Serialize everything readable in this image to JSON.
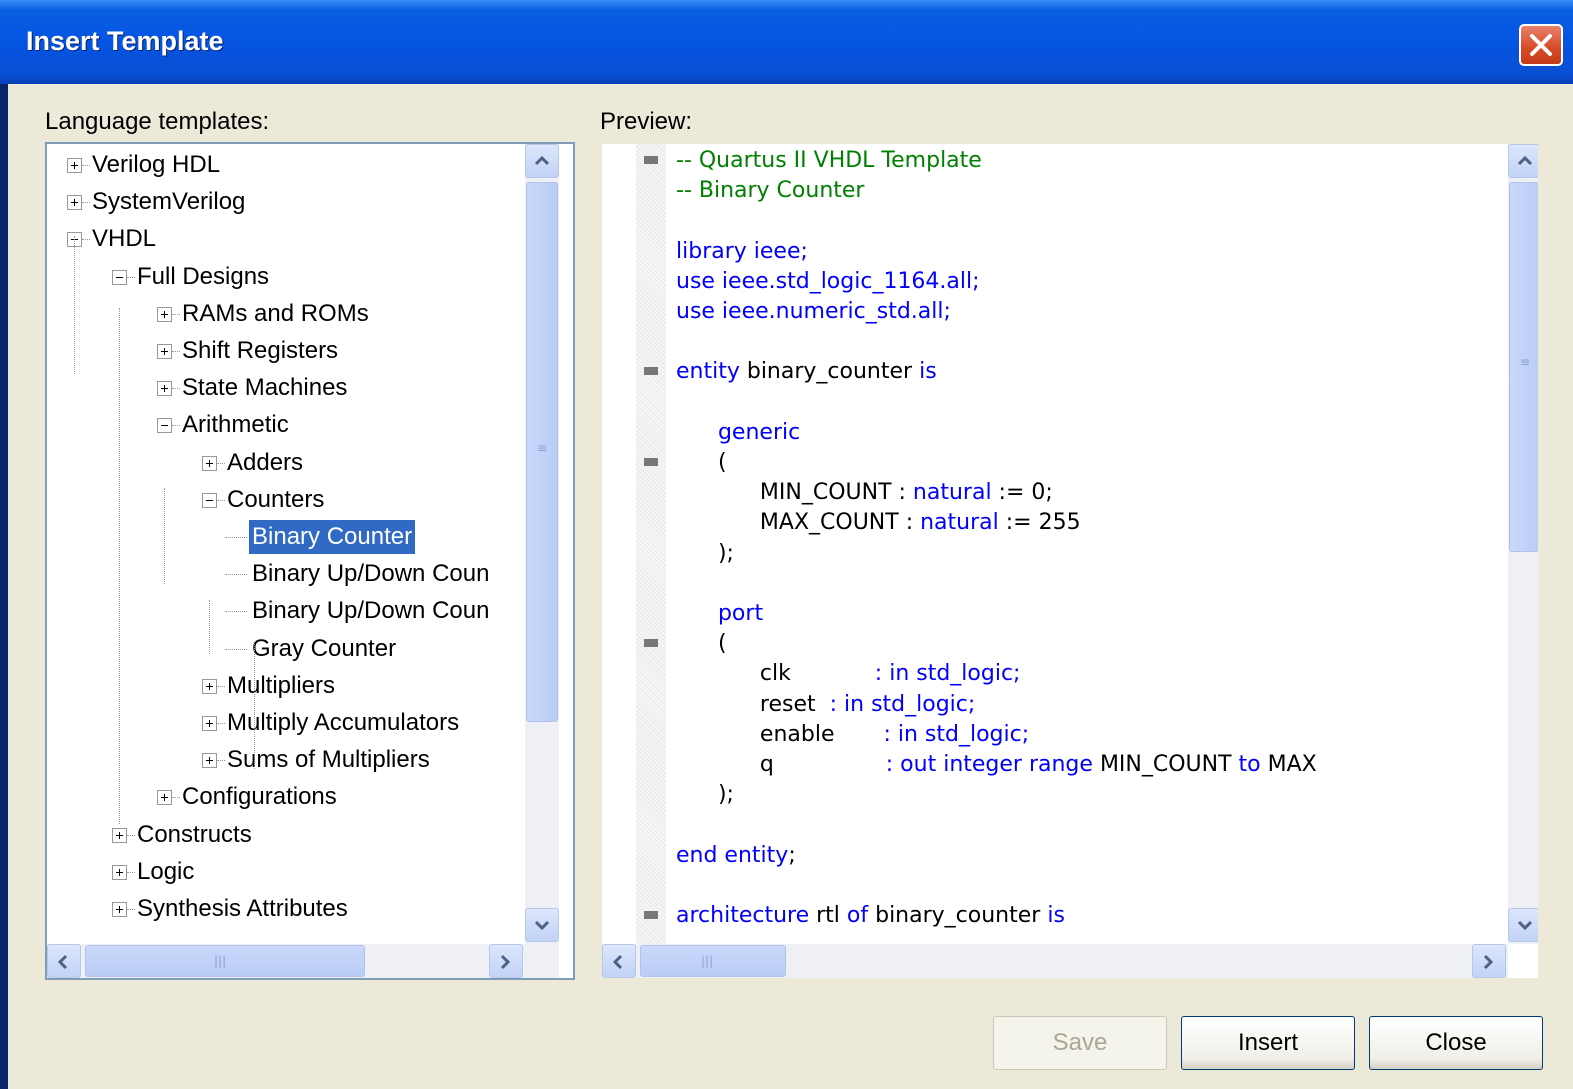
{
  "window": {
    "title": "Insert Template"
  },
  "left_panel": {
    "label": "Language templates:"
  },
  "right_panel": {
    "label": "Preview:"
  },
  "tree": [
    {
      "label": "Verilog HDL",
      "level": 0,
      "expander": "plus"
    },
    {
      "label": "SystemVerilog",
      "level": 0,
      "expander": "plus"
    },
    {
      "label": "VHDL",
      "level": 0,
      "expander": "minus"
    },
    {
      "label": "Full Designs",
      "level": 1,
      "expander": "minus"
    },
    {
      "label": "RAMs and ROMs",
      "level": 2,
      "expander": "plus"
    },
    {
      "label": "Shift Registers",
      "level": 2,
      "expander": "plus"
    },
    {
      "label": "State Machines",
      "level": 2,
      "expander": "plus"
    },
    {
      "label": "Arithmetic",
      "level": 2,
      "expander": "minus"
    },
    {
      "label": "Adders",
      "level": 3,
      "expander": "plus"
    },
    {
      "label": "Counters",
      "level": 3,
      "expander": "minus"
    },
    {
      "label": "Binary Counter",
      "level": 4,
      "expander": "none",
      "selected": true
    },
    {
      "label": "Binary Up/Down Coun",
      "level": 4,
      "expander": "none"
    },
    {
      "label": "Binary Up/Down Coun",
      "level": 4,
      "expander": "none"
    },
    {
      "label": "Gray Counter",
      "level": 4,
      "expander": "none"
    },
    {
      "label": "Multipliers",
      "level": 3,
      "expander": "plus"
    },
    {
      "label": "Multiply Accumulators",
      "level": 3,
      "expander": "plus"
    },
    {
      "label": "Sums of Multipliers",
      "level": 3,
      "expander": "plus"
    },
    {
      "label": "Configurations",
      "level": 2,
      "expander": "plus"
    },
    {
      "label": "Constructs",
      "level": 1,
      "expander": "plus"
    },
    {
      "label": "Logic",
      "level": 1,
      "expander": "plus"
    },
    {
      "label": "Synthesis Attributes",
      "level": 1,
      "expander": "plus"
    }
  ],
  "code_lines": [
    {
      "fold": true,
      "tokens": [
        [
          "c-com",
          "-- Quartus II VHDL Template"
        ]
      ]
    },
    {
      "fold": false,
      "tokens": [
        [
          "c-com",
          "-- Binary Counter"
        ]
      ]
    },
    {
      "fold": false,
      "tokens": []
    },
    {
      "fold": false,
      "tokens": [
        [
          "c-kw",
          "library ieee;"
        ]
      ]
    },
    {
      "fold": false,
      "tokens": [
        [
          "c-kw",
          "use ieee.std_logic_1164.all;"
        ]
      ]
    },
    {
      "fold": false,
      "tokens": [
        [
          "c-kw",
          "use ieee.numeric_std.all;"
        ]
      ]
    },
    {
      "fold": false,
      "tokens": []
    },
    {
      "fold": true,
      "tokens": [
        [
          "c-kw",
          "entity "
        ],
        [
          "c-id",
          "binary_counter "
        ],
        [
          "c-kw",
          "is"
        ]
      ]
    },
    {
      "fold": false,
      "tokens": []
    },
    {
      "fold": false,
      "tokens": [
        [
          "c-id",
          "      "
        ],
        [
          "c-kw",
          "generic"
        ]
      ]
    },
    {
      "fold": true,
      "tokens": [
        [
          "c-id",
          "      ("
        ]
      ]
    },
    {
      "fold": false,
      "tokens": [
        [
          "c-id",
          "            MIN_COUNT : "
        ],
        [
          "c-kw",
          "natural"
        ],
        [
          "c-id",
          " := 0;"
        ]
      ]
    },
    {
      "fold": false,
      "tokens": [
        [
          "c-id",
          "            MAX_COUNT : "
        ],
        [
          "c-kw",
          "natural"
        ],
        [
          "c-id",
          " := 255"
        ]
      ]
    },
    {
      "fold": false,
      "tokens": [
        [
          "c-id",
          "      );"
        ]
      ]
    },
    {
      "fold": false,
      "tokens": []
    },
    {
      "fold": false,
      "tokens": [
        [
          "c-id",
          "      "
        ],
        [
          "c-kw",
          "port"
        ]
      ]
    },
    {
      "fold": true,
      "tokens": [
        [
          "c-id",
          "      ("
        ]
      ]
    },
    {
      "fold": false,
      "tokens": [
        [
          "c-id",
          "            clk            "
        ],
        [
          "c-kw",
          ": in std_logic;"
        ]
      ]
    },
    {
      "fold": false,
      "tokens": [
        [
          "c-id",
          "            reset  "
        ],
        [
          "c-kw",
          ": in std_logic;"
        ]
      ]
    },
    {
      "fold": false,
      "tokens": [
        [
          "c-id",
          "            enable       "
        ],
        [
          "c-kw",
          ": in std_logic;"
        ]
      ]
    },
    {
      "fold": false,
      "tokens": [
        [
          "c-id",
          "            q                "
        ],
        [
          "c-kw",
          ": out integer range "
        ],
        [
          "c-id",
          "MIN_COUNT "
        ],
        [
          "c-kw",
          "to "
        ],
        [
          "c-id",
          "MAX"
        ]
      ]
    },
    {
      "fold": false,
      "tokens": [
        [
          "c-id",
          "      );"
        ]
      ]
    },
    {
      "fold": false,
      "tokens": []
    },
    {
      "fold": false,
      "tokens": [
        [
          "c-kw",
          "end entity"
        ],
        [
          "c-id",
          ";"
        ]
      ]
    },
    {
      "fold": false,
      "tokens": []
    },
    {
      "fold": true,
      "tokens": [
        [
          "c-kw",
          "architecture "
        ],
        [
          "c-id",
          "rtl "
        ],
        [
          "c-kw",
          "of "
        ],
        [
          "c-id",
          "binary_counter "
        ],
        [
          "c-kw",
          "is"
        ]
      ]
    }
  ],
  "buttons": {
    "save": "Save",
    "insert": "Insert",
    "close": "Close"
  },
  "icons": {
    "close": "close-icon",
    "scroll_up": "scroll-up-icon",
    "scroll_down": "scroll-down-icon",
    "scroll_left": "scroll-left-icon",
    "scroll_right": "scroll-right-icon"
  },
  "colors": {
    "title_bar": "#0554e3",
    "selection": "#316ac5",
    "comment": "#008000",
    "keyword": "#0000ff",
    "dialog_bg": "#ece9d8"
  }
}
